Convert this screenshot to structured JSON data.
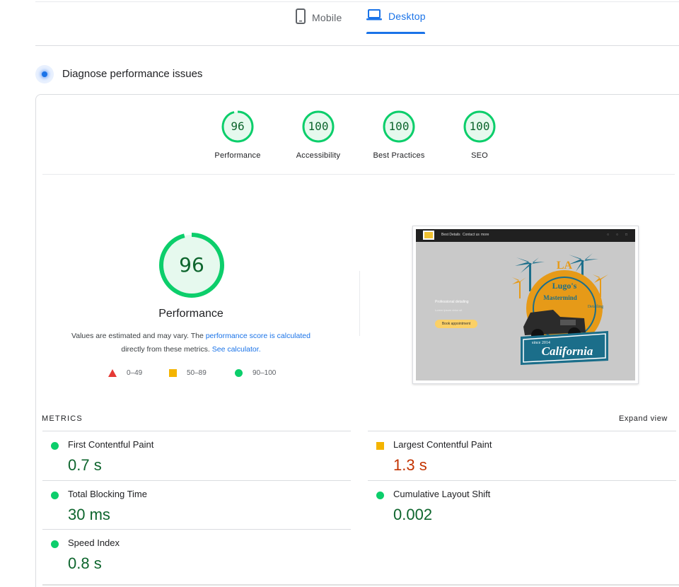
{
  "tabs": {
    "mobile_label": "Mobile",
    "desktop_label": "Desktop",
    "active": "Desktop"
  },
  "diagnose": {
    "title": "Diagnose performance issues"
  },
  "category_scores": [
    {
      "label": "Performance",
      "score": "96"
    },
    {
      "label": "Accessibility",
      "score": "100"
    },
    {
      "label": "Best Practices",
      "score": "100"
    },
    {
      "label": "SEO",
      "score": "100"
    }
  ],
  "performance": {
    "score": "96",
    "label": "Performance",
    "note_text_1": "Values are estimated and may vary. The",
    "note_link_1": "performance score is calculated",
    "note_text_2": "directly from these metrics.",
    "note_link_2": "See calculator."
  },
  "legend": {
    "fail": "0–49",
    "average": "50–89",
    "pass": "90–100"
  },
  "colors": {
    "pass": "#0cce6b",
    "pass_text": "#0d652d",
    "average": "#f4b400",
    "average_text": "#c33300",
    "fail": "#e53935",
    "accent": "#1a73e8"
  },
  "metrics": {
    "heading": "METRICS",
    "expand_label": "Expand view",
    "items": [
      {
        "name": "First Contentful Paint",
        "value": "0.7 s",
        "rating": "pass"
      },
      {
        "name": "Largest Contentful Paint",
        "value": "1.3 s",
        "rating": "average"
      },
      {
        "name": "Total Blocking Time",
        "value": "30 ms",
        "rating": "pass"
      },
      {
        "name": "Cumulative Layout Shift",
        "value": "0.002",
        "rating": "pass"
      },
      {
        "name": "Speed Index",
        "value": "0.8 s",
        "rating": "pass"
      }
    ]
  },
  "thumbnail": {
    "nav_items": [
      "Best Details",
      "Contact us",
      "more"
    ],
    "hero_heading": "Professional detailing",
    "hero_sub": "Lorem ipsum dolor sit",
    "cta_label": "Book appointment",
    "logo_top": "LA",
    "logo_name": "Lugo's",
    "logo_line": "Mastermind",
    "logo_line2": "Detailing",
    "logo_since": "since 2014",
    "logo_state": "California"
  }
}
